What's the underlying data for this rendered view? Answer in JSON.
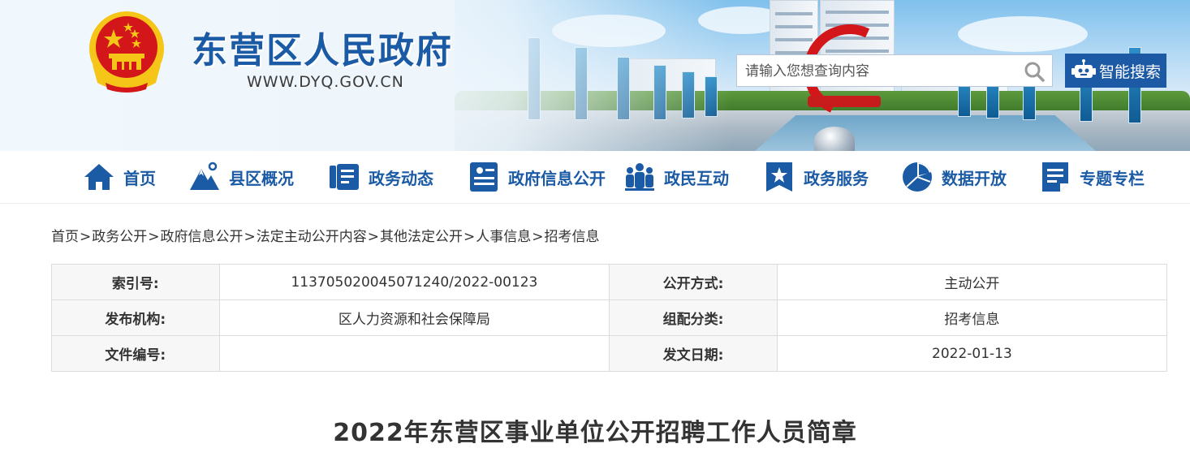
{
  "header": {
    "site_title": "东营区人民政府",
    "site_url": "WWW.DYQ.GOV.CN",
    "search_placeholder": "请输入您想查询内容",
    "smart_search_label": "智能搜索"
  },
  "nav": {
    "items": [
      {
        "label": "首页",
        "icon": "home-icon"
      },
      {
        "label": "县区概况",
        "icon": "mountain-icon"
      },
      {
        "label": "政务动态",
        "icon": "news-icon"
      },
      {
        "label": "政府信息公开",
        "icon": "document-icon"
      },
      {
        "label": "政民互动",
        "icon": "people-icon"
      },
      {
        "label": "政务服务",
        "icon": "star-bookmark-icon"
      },
      {
        "label": "数据开放",
        "icon": "pie-chart-icon"
      },
      {
        "label": "专题专栏",
        "icon": "notepad-icon"
      }
    ]
  },
  "breadcrumb": [
    "首页",
    "政务公开",
    "政府信息公开",
    "法定主动公开内容",
    "其他法定公开",
    "人事信息",
    "招考信息"
  ],
  "breadcrumb_separator": ">",
  "info": {
    "index_label": "索引号:",
    "index_value": "11370502004507124​0/2022-00123",
    "open_mode_label": "公开方式:",
    "open_mode_value": "主动公开",
    "issuer_label": "发布机构:",
    "issuer_value": "区人力资源和社会保障局",
    "category_label": "组配分类:",
    "category_value": "招考信息",
    "doc_no_label": "文件编号:",
    "doc_no_value": "",
    "date_label": "发文日期:",
    "date_value": "2022-01-13"
  },
  "article": {
    "title": "2022年东营区事业单位公开招聘工作人员简章"
  },
  "colors": {
    "brand_blue": "#1b5aa5",
    "emblem_red": "#d3161a",
    "emblem_gold": "#f5c518"
  }
}
